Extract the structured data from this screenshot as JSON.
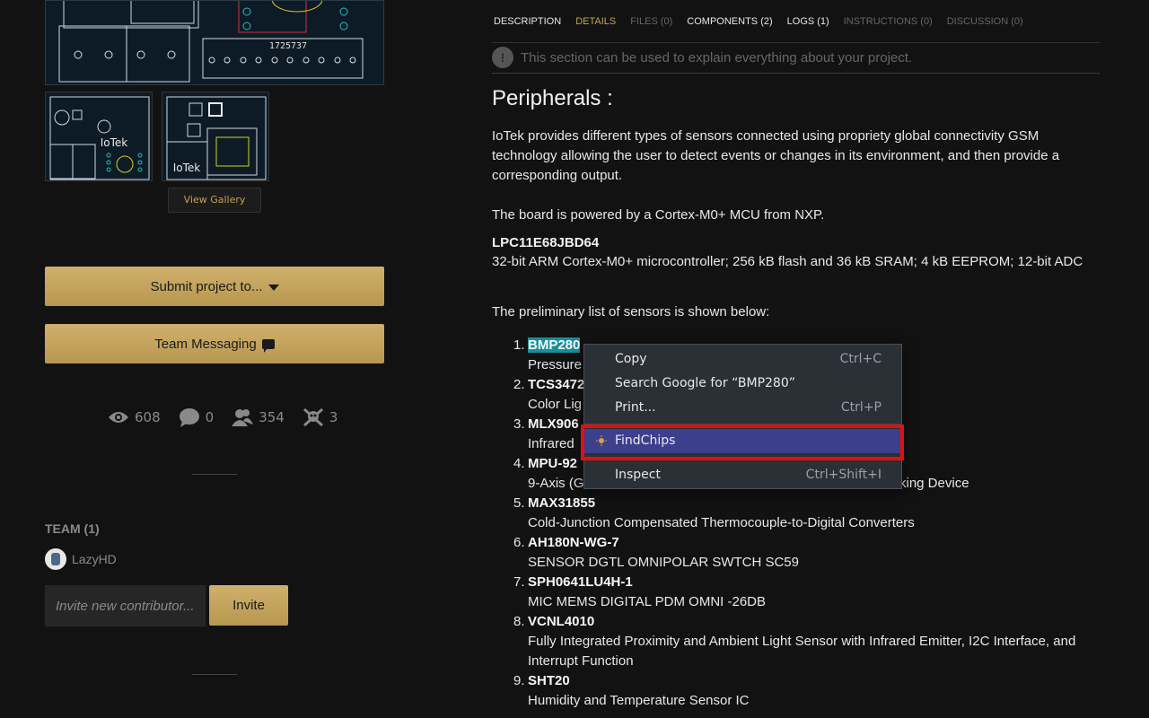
{
  "gallery": {
    "main_image_label": "1725737",
    "thumb1_label": "IoTek",
    "thumb2_label": "IoTek",
    "view_gallery_label": "View Gallery"
  },
  "actions": {
    "submit_label": "Submit project to...",
    "team_messaging_label": "Team Messaging"
  },
  "stats": {
    "views": "608",
    "comments": "0",
    "followers": "354",
    "skulls": "3"
  },
  "team": {
    "label": "TEAM (1)",
    "member_name": "LazyHD",
    "invite_placeholder": "Invite new contributor...",
    "invite_button": "Invite"
  },
  "tabs": [
    {
      "label": "DESCRIPTION"
    },
    {
      "label": "DETAILS"
    },
    {
      "label": "FILES (0)"
    },
    {
      "label": "COMPONENTS (2)"
    },
    {
      "label": "LOGS (1)"
    },
    {
      "label": "INSTRUCTIONS (0)"
    },
    {
      "label": "DISCUSSION (0)"
    }
  ],
  "info": {
    "text": "This section can be used to explain everything about your project."
  },
  "content": {
    "heading": "Peripherals :",
    "p1": "IoTek provides different types of sensors connected using propriety global connectivity GSM technology allowing the user to detect events or changes in its environment, and then provide a corresponding output.",
    "p2": "The board is powered by a Cortex-M0+ MCU from NXP.",
    "mcu_name": "LPC11E68JBD64",
    "mcu_desc": "32-bit ARM Cortex-M0+ microcontroller; 256 kB flash and 36 kB SRAM; 4 kB EEPROM; 12-bit ADC",
    "p3": "The preliminary list of sensors is shown below:"
  },
  "sensors": [
    {
      "num": "1.",
      "name": "BMP280",
      "desc": "Pressure"
    },
    {
      "num": "2.",
      "name": "TCS3472",
      "desc": "Color Lig"
    },
    {
      "num": "3.",
      "name": "MLX906",
      "desc": "Infrared"
    },
    {
      "num": "4.",
      "name": "MPU-92",
      "desc": "9-Axis (G",
      "desc_tail": "king Device"
    },
    {
      "num": "5.",
      "name": "MAX31855",
      "desc": "Cold-Junction Compensated Thermocouple-to-Digital Converters"
    },
    {
      "num": "6.",
      "name": "AH180N-WG-7",
      "desc": "SENSOR DGTL OMNIPOLAR SWTCH SC59"
    },
    {
      "num": "7.",
      "name": "SPH0641LU4H-1",
      "desc": "MIC MEMS DIGITAL PDM OMNI -26DB"
    },
    {
      "num": "8.",
      "name": "VCNL4010",
      "desc": "Fully Integrated Proximity and Ambient Light Sensor with Infrared Emitter, I2C Interface, and Interrupt Function"
    },
    {
      "num": "9.",
      "name": "SHT20",
      "desc": "Humidity and Temperature Sensor IC"
    }
  ],
  "context_menu": {
    "copy": "Copy",
    "copy_sc": "Ctrl+C",
    "search": "Search Google for “BMP280”",
    "print": "Print...",
    "print_sc": "Ctrl+P",
    "findchips": "FindChips",
    "inspect": "Inspect",
    "inspect_sc": "Ctrl+Shift+I"
  },
  "colors": {
    "accent_gold": "#c8a24e",
    "highlight": "#1a8f9c",
    "menu_selected": "#3b3f8c",
    "annotation_red": "#e01010"
  }
}
